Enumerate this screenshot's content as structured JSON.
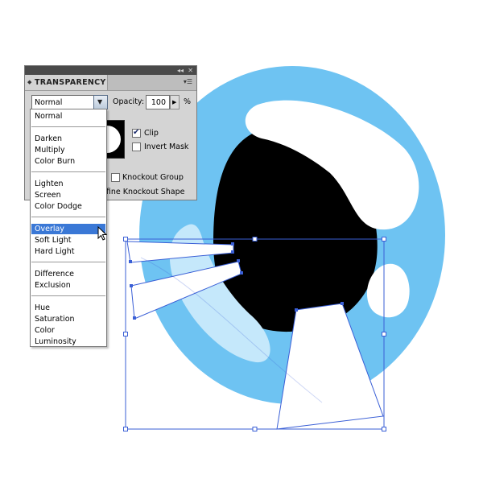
{
  "panel": {
    "title": "TRANSPARENCY",
    "blend_mode": "Normal",
    "opacity_label": "Opacity:",
    "opacity_value": "100",
    "opacity_unit": "%",
    "clip_label": "Clip",
    "clip_checked": true,
    "invert_mask_label": "Invert Mask",
    "knockout_group_label": "Knockout Group",
    "define_knockout_label": "efine Knockout Shape"
  },
  "blend_menu": {
    "items": [
      "Normal",
      "Darken",
      "Multiply",
      "Color Burn",
      "Lighten",
      "Screen",
      "Color Dodge",
      "Overlay",
      "Soft Light",
      "Hard Light",
      "Difference",
      "Exclusion",
      "Hue",
      "Saturation",
      "Color",
      "Luminosity"
    ],
    "highlighted": "Overlay"
  },
  "colors": {
    "iris": "#6ec3f2",
    "pupil": "#000000",
    "highlight_reflection": "#c5e8fb",
    "selection": "#3a5fd6",
    "menu_highlight": "#3a78d6"
  }
}
